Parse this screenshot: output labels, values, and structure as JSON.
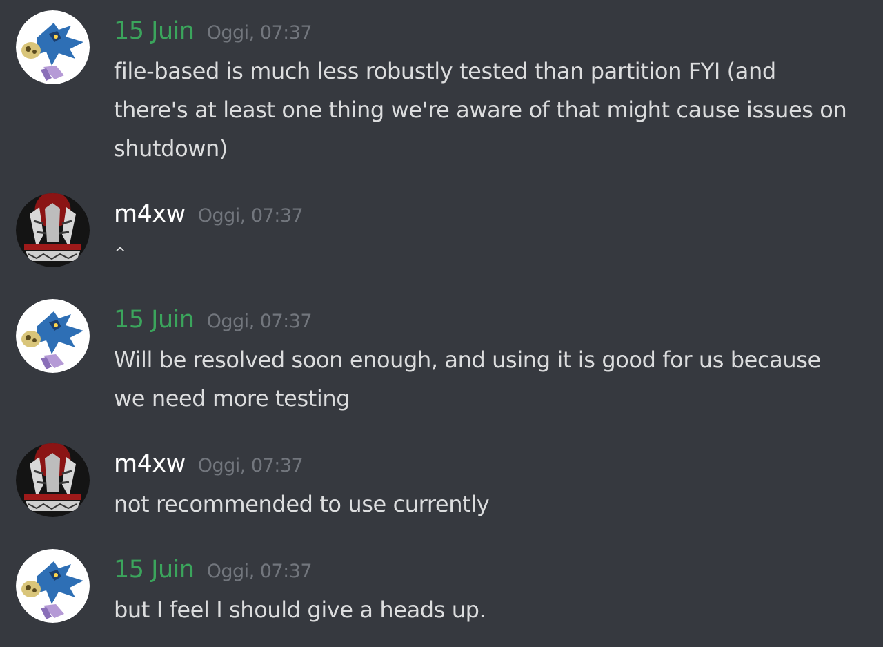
{
  "messages": [
    {
      "author": "15 Juin",
      "timestamp": "Oggi, 07:37",
      "lines": [
        "file-based is much less robustly tested than partition FYI (and",
        "there's at least one thing we're aware of that might cause issues on",
        "shutdown)"
      ]
    },
    {
      "author": "m4xw",
      "timestamp": "Oggi, 07:37",
      "lines": [
        "^"
      ]
    },
    {
      "author": "15 Juin",
      "timestamp": "Oggi, 07:37",
      "lines": [
        "Will be resolved soon enough, and using it is good for us because",
        "we need more testing"
      ]
    },
    {
      "author": "m4xw",
      "timestamp": "Oggi, 07:37",
      "lines": [
        "not recommended to use currently"
      ]
    },
    {
      "author": "15 Juin",
      "timestamp": "Oggi, 07:37",
      "lines": [
        "but I feel I should give a heads up."
      ]
    }
  ],
  "colors": {
    "background": "#36393f",
    "author_green": "#3ba55c",
    "author_white": "#ffffff",
    "timestamp": "#72767d",
    "text": "#dcddde"
  },
  "icons": {
    "juin_avatar": "blue-dragon-avatar-icon",
    "m4xw_avatar": "dark-artwork-avatar-icon"
  }
}
